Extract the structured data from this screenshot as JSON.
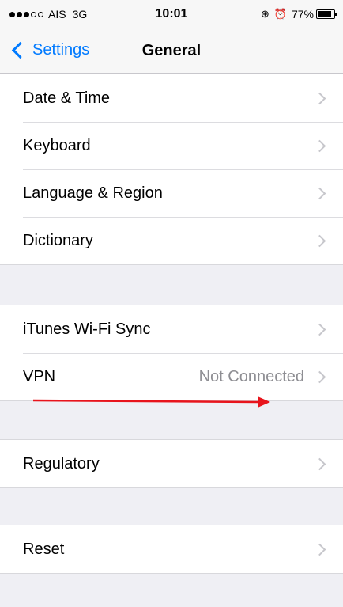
{
  "status_bar": {
    "carrier": "AIS",
    "network": "3G",
    "time": "10:01",
    "battery_percent": "77%",
    "battery_level": 0.77,
    "signal_bars": 3,
    "signal_max": 5,
    "icons": [
      "signal-dots-icon",
      "lock-rotation-icon",
      "alarm-icon",
      "battery-icon"
    ]
  },
  "nav": {
    "back_label": "Settings",
    "title": "General"
  },
  "groups": [
    {
      "rows": [
        {
          "label": "Date & Time",
          "value": ""
        },
        {
          "label": "Keyboard",
          "value": ""
        },
        {
          "label": "Language & Region",
          "value": ""
        },
        {
          "label": "Dictionary",
          "value": ""
        }
      ]
    },
    {
      "rows": [
        {
          "label": "iTunes Wi-Fi Sync",
          "value": ""
        },
        {
          "label": "VPN",
          "value": "Not Connected"
        }
      ]
    },
    {
      "rows": [
        {
          "label": "Regulatory",
          "value": ""
        }
      ]
    },
    {
      "rows": [
        {
          "label": "Reset",
          "value": ""
        }
      ]
    }
  ],
  "colors": {
    "accent": "#007aff",
    "background": "#efeff4",
    "annotation_arrow": "#e8141c"
  }
}
